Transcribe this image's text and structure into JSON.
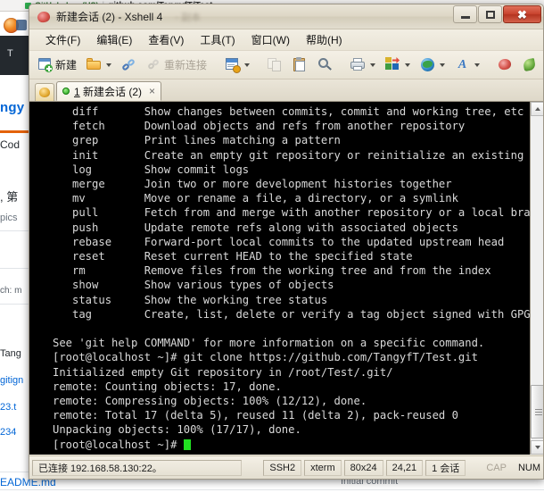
{
  "background": {
    "urlbar": {
      "identity": "GitHub, Inc. (US)",
      "url_prefix": "https://",
      "url_main": "github.com/TangyfT/Test"
    },
    "repo_owner": "ngy",
    "tab_code": "Cod",
    "description": ", 第",
    "topics": "pics",
    "branch": "ch: m",
    "files": [
      "Tang",
      "gitign",
      "23.t",
      "234"
    ],
    "bottom_file": "EADME.md",
    "bottom_commit": "Initial commit"
  },
  "window": {
    "title": "新建会话 (2) - Xshell 4",
    "ghost_title": "- 副本",
    "controls": {
      "minimize": "最小化",
      "maximize": "还原",
      "close": "✖"
    }
  },
  "menu": {
    "items": [
      {
        "label": "文件(F)"
      },
      {
        "label": "编辑(E)"
      },
      {
        "label": "查看(V)"
      },
      {
        "label": "工具(T)"
      },
      {
        "label": "窗口(W)"
      },
      {
        "label": "帮助(H)"
      }
    ]
  },
  "toolbar": {
    "new_label": "新建",
    "reconnect_label": "重新连接"
  },
  "tabs": {
    "session_icon": "xshell-session-icon",
    "items": [
      {
        "index": "1",
        "label": "新建会话 (2)",
        "close": "×",
        "status": "connected"
      }
    ]
  },
  "terminal": {
    "lines": [
      "   diff       Show changes between commits, commit and working tree, etc",
      "   fetch      Download objects and refs from another repository",
      "   grep       Print lines matching a pattern",
      "   init       Create an empty git repository or reinitialize an existing one",
      "   log        Show commit logs",
      "   merge      Join two or more development histories together",
      "   mv         Move or rename a file, a directory, or a symlink",
      "   pull       Fetch from and merge with another repository or a local branch",
      "   push       Update remote refs along with associated objects",
      "   rebase     Forward-port local commits to the updated upstream head",
      "   reset      Reset current HEAD to the specified state",
      "   rm         Remove files from the working tree and from the index",
      "   show       Show various types of objects",
      "   status     Show the working tree status",
      "   tag        Create, list, delete or verify a tag object signed with GPG",
      "",
      "See 'git help COMMAND' for more information on a specific command.",
      "[root@localhost ~]# git clone https://github.com/TangyfT/Test.git",
      "Initialized empty Git repository in /root/Test/.git/",
      "remote: Counting objects: 17, done.",
      "remote: Compressing objects: 100% (12/12), done.",
      "remote: Total 17 (delta 5), reused 11 (delta 2), pack-reused 0",
      "Unpacking objects: 100% (17/17), done."
    ],
    "prompt": "[root@localhost ~]# "
  },
  "statusbar": {
    "connection": "已连接 192.168.58.130:22。",
    "protocol": "SSH2",
    "term_type": "xterm",
    "size": "80x24",
    "cursor": "24,21",
    "sessions": "1 会话",
    "caps": "CAP",
    "num": "NUM"
  }
}
